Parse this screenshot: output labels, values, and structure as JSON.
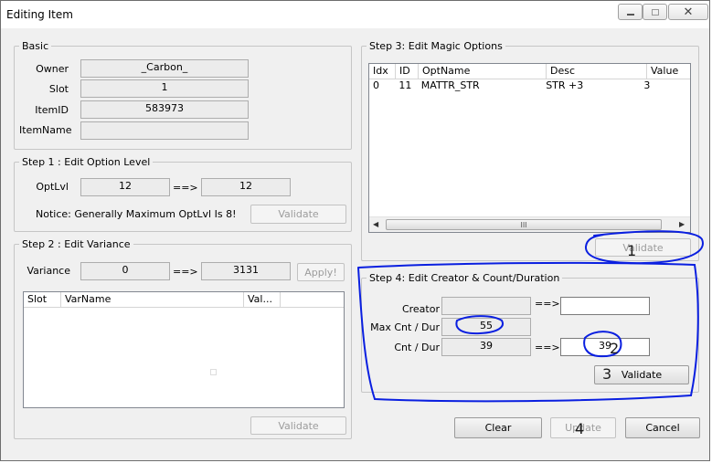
{
  "window": {
    "title": "Editing Item"
  },
  "basic": {
    "title": "Basic",
    "owner_label": "Owner",
    "owner_value": "_Carbon_",
    "slot_label": "Slot",
    "slot_value": "1",
    "itemid_label": "ItemID",
    "itemid_value": "583973",
    "itemname_label": "ItemName",
    "itemname_value": ""
  },
  "step1": {
    "title": "Step 1 : Edit Option Level",
    "optlvl_label": "OptLvl",
    "current": "12",
    "arrow": "==>",
    "new_value": "12",
    "notice": "Notice: Generally Maximum OptLvl Is 8!",
    "validate_label": "Validate"
  },
  "step2": {
    "title": "Step 2 : Edit Variance",
    "variance_label": "Variance",
    "current": "0",
    "arrow": "==>",
    "new_value": "3131",
    "apply_label": "Apply!",
    "columns": [
      "Slot",
      "VarName",
      "Val..."
    ],
    "validate_label": "Validate"
  },
  "step3": {
    "title": "Step 3: Edit Magic Options",
    "columns": [
      "Idx",
      "ID",
      "OptName",
      "Desc",
      "Value"
    ],
    "rows": [
      {
        "idx": "0",
        "id": "11",
        "optname": "MATTR_STR",
        "desc": "STR +3",
        "value": "3"
      }
    ],
    "scroll_grip": "III",
    "validate_label": "Validate"
  },
  "step4": {
    "title": "Step 4: Edit Creator & Count/Duration",
    "creator_label": "Creator",
    "creator_value": "",
    "creator_arrow": "==>",
    "creator_new": "",
    "maxcnt_label": "Max Cnt / Dur",
    "maxcnt_value": "55",
    "cnt_label": "Cnt / Dur",
    "cnt_value": "39",
    "cnt_arrow": "==>",
    "cnt_new": "39",
    "validate_label": "Validate"
  },
  "footer": {
    "clear_label": "Clear",
    "update_label": "Update",
    "cancel_label": "Cancel"
  },
  "annotations": {
    "mark1": "1",
    "mark2": "2",
    "mark3": "3",
    "mark4": "4"
  },
  "colors": {
    "annotation_ink": "#0a1fe0"
  }
}
